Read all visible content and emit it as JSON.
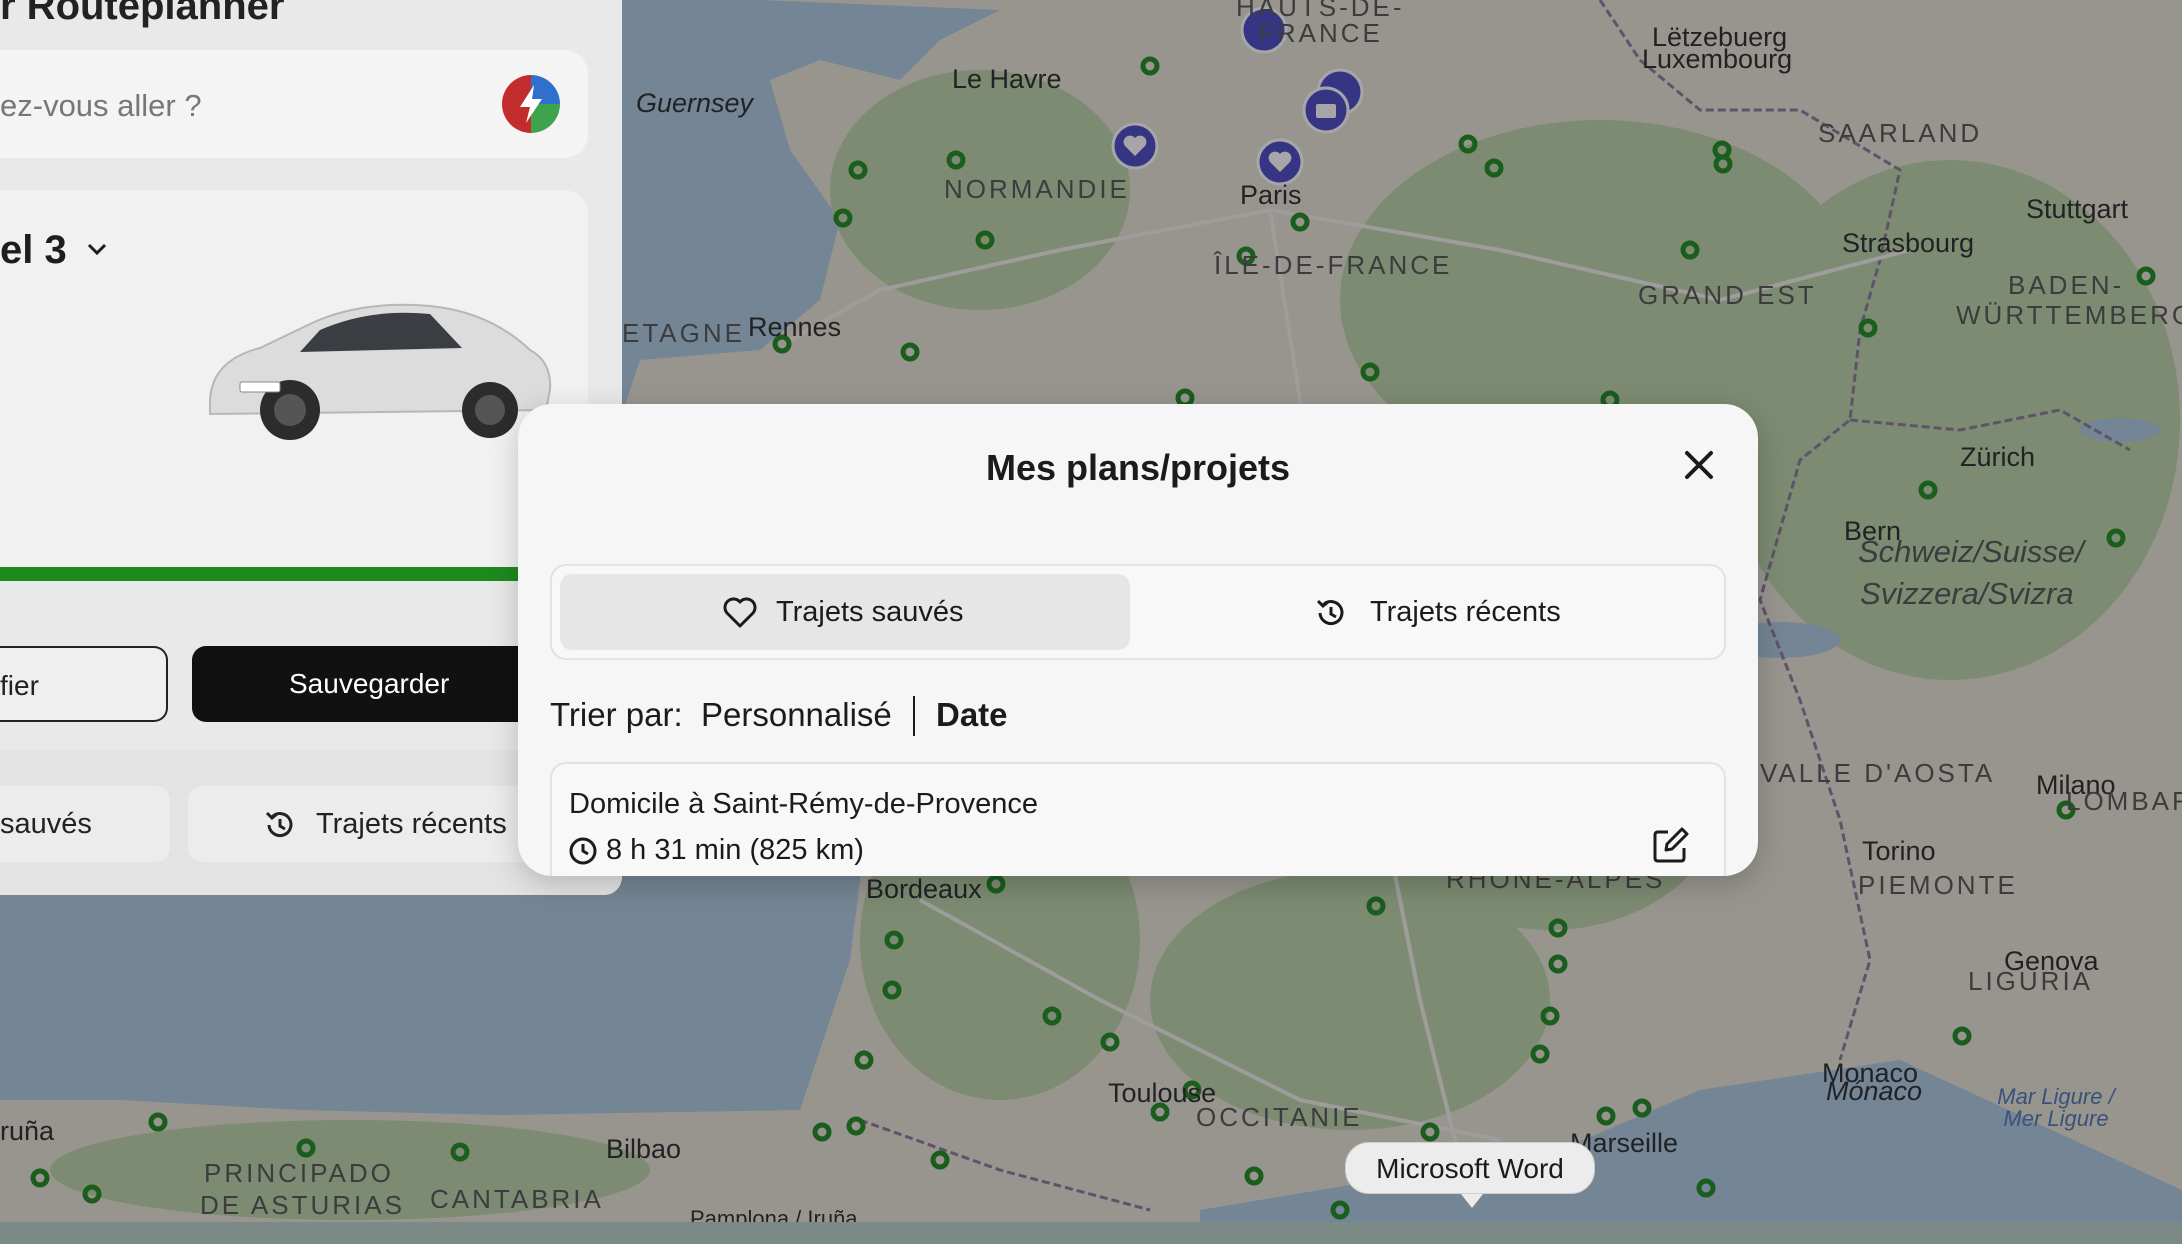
{
  "left_panel": {
    "title": "r Routeplanner",
    "search_placeholder": "ez-vous aller ?",
    "car_model": "el 3",
    "modify_label": "fier",
    "save_label": "Sauvegarder",
    "tab_saved": "sauvés",
    "tab_recent": "Trajets récents"
  },
  "modal": {
    "title": "Mes plans/projets",
    "tabs": [
      {
        "label": "Trajets sauvés",
        "icon": "heart-icon",
        "active": true
      },
      {
        "label": "Trajets récents",
        "icon": "history-icon",
        "active": false
      }
    ],
    "sort": {
      "label": "Trier par:",
      "options": [
        "Personnalisé",
        "Date"
      ],
      "selected": "Date"
    },
    "trips": [
      {
        "name": "Domicile à Saint-Rémy-de-Provence",
        "duration": "8 h 31 min (825 km)"
      }
    ]
  },
  "tooltip": {
    "text": "Microsoft Word"
  },
  "map": {
    "labels": {
      "hauts_de_france_1": "HAUTS-DE-",
      "hauts_de_france_2": "FRANCE",
      "letzebuerg": "Lëtzebuerg",
      "luxembourg": "Luxembourg",
      "le_havre": "Le Havre",
      "guernsey": "Guernsey",
      "saarland": "SAARLAND",
      "normandie": "NORMANDIE",
      "paris": "Paris",
      "stuttgart": "Stuttgart",
      "strasbourg": "Strasbourg",
      "ile_de_france": "ÎLE-DE-FRANCE",
      "baden_1": "BADEN-",
      "baden_2": "WÜRTTEMBERG",
      "grand_est": "GRAND EST",
      "etagne": "ETAGNE",
      "rennes": "Rennes",
      "zurich": "Zürich",
      "bern": "Bern",
      "schweiz_1": "Schweiz/Suisse/",
      "schweiz_2": "Svizzera/Svizra",
      "valle_daosta": "VALLE D'AOSTA",
      "milano": "Milano",
      "lombar": "LOMBAR",
      "rhone_alpes": "RHÔNE-ALPES",
      "torino": "Torino",
      "piemonte": "PIEMONTE",
      "bordeaux": "Bordeaux",
      "genova": "Genova",
      "liguria": "LIGURIA",
      "toulouse": "Toulouse",
      "occitanie": "OCCITANIE",
      "monaco_1": "Monaco",
      "monaco_2": "Mónaco",
      "mar_ligure": "Mar Ligure / Mer Ligure",
      "marseille": "Marseille",
      "coruna": "ruña",
      "bilbao": "Bilbao",
      "principado_1": "PRINCIPADO",
      "principado_2": "DE ASTURIAS",
      "cantabria": "CANTABRIA",
      "pamplona": "Pamplona / Iruña"
    },
    "colors": {
      "sea": "#aecadf",
      "land": "#e8e4d6",
      "forest": "#bcd3a7",
      "charger": "#1e8a1e",
      "poi": "#4b49c4"
    }
  }
}
